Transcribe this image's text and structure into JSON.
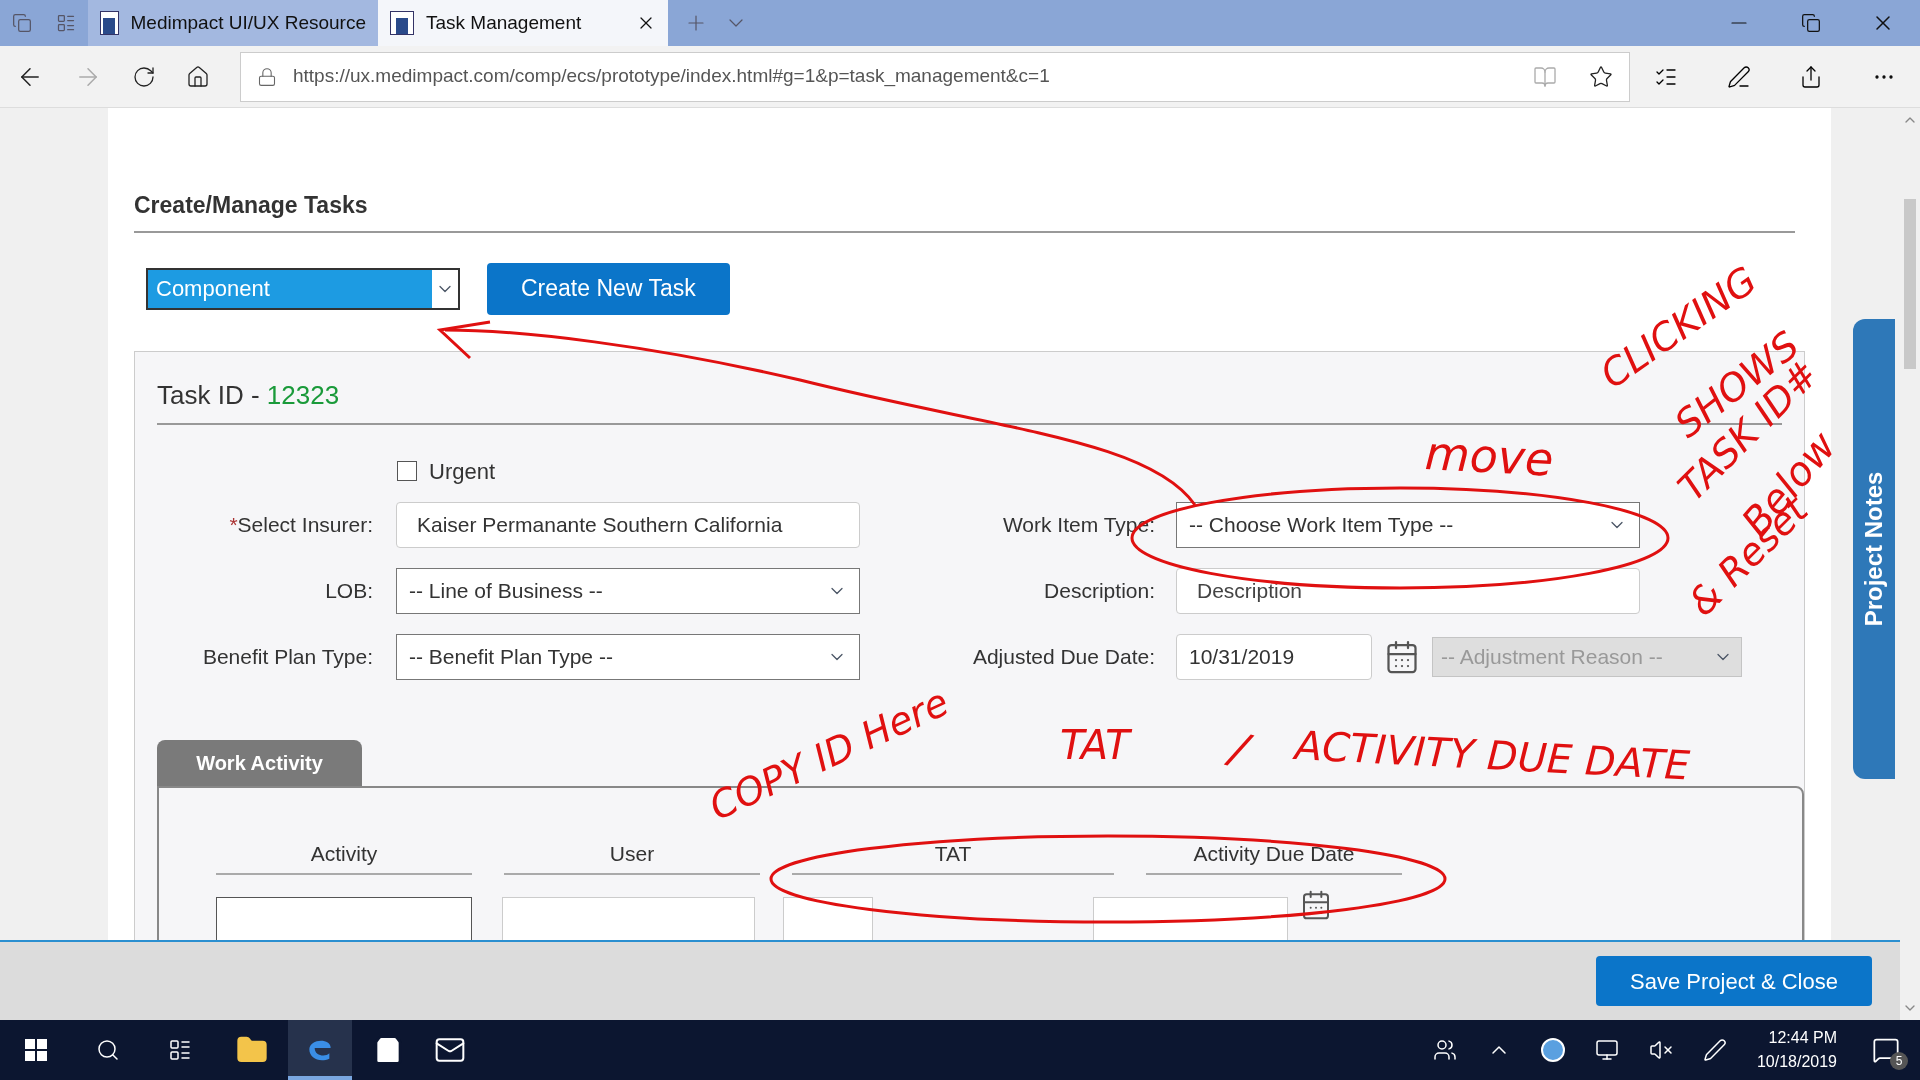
{
  "browser": {
    "tabs": [
      {
        "title": "Medimpact UI/UX Resource",
        "selected": false
      },
      {
        "title": "Task Management",
        "selected": true
      }
    ],
    "url": "https://ux.medimpact.com/comp/ecs/prototype/index.html#g=1&p=task_management&c=1"
  },
  "page": {
    "title": "Create/Manage Tasks",
    "type_select": "Component",
    "create_button": "Create New Task",
    "task": {
      "id_label": "Task ID - ",
      "id": "12323",
      "urgent": {
        "label": "Urgent",
        "checked": false
      },
      "left_fields": [
        {
          "kind": "text",
          "marker": "*",
          "label": "Select Insurer:",
          "value": "Kaiser Permanante Southern California"
        },
        {
          "kind": "select",
          "label": "LOB:",
          "value": "-- Line of Business --"
        },
        {
          "kind": "select",
          "label": "Benefit Plan Type:",
          "value": "-- Benefit Plan Type --"
        }
      ],
      "right_fields": [
        {
          "kind": "select",
          "label": "Work Item Type:",
          "value": "-- Choose Work Item Type --"
        },
        {
          "kind": "text",
          "label": "Description:",
          "placeholder": "Description"
        },
        {
          "kind": "date",
          "label": "Adjusted Due Date:",
          "value": "10/31/2019",
          "extra": {
            "value": "-- Adjustment Reason --",
            "disabled": true
          }
        }
      ]
    },
    "work_activity": {
      "tab": "Work Activity",
      "columns": [
        "Activity",
        "User",
        "TAT",
        "Activity Due Date"
      ]
    }
  },
  "side_tab": "Project Notes",
  "footer": {
    "save_button": "Save Project & Close"
  },
  "annotations": [
    {
      "text": "move"
    },
    {
      "text": "CLICKING"
    },
    {
      "text": "SHOWS"
    },
    {
      "text": "TASK ID#"
    },
    {
      "text": "Below"
    },
    {
      "text": "& Reset"
    },
    {
      "text": "COPY ID Here"
    },
    {
      "text": "TAT"
    },
    {
      "text": "/"
    },
    {
      "text": "ACTIVITY DUE DATE"
    }
  ],
  "taskbar": {
    "time": "12:44 PM",
    "date": "10/18/2019",
    "notifications": "5"
  }
}
